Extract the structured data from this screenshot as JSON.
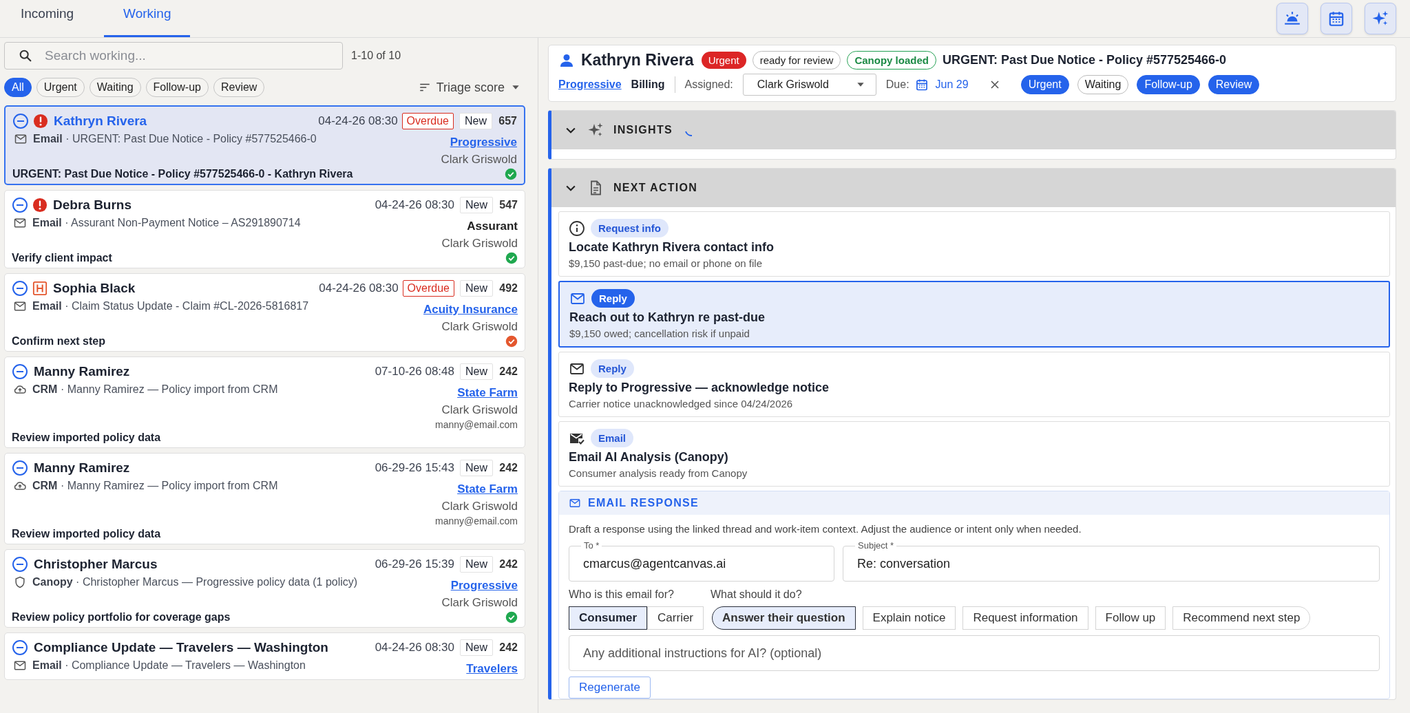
{
  "tabs": [
    {
      "label": "Incoming",
      "selected": false
    },
    {
      "label": "Working",
      "selected": true
    }
  ],
  "toolbar": [
    {
      "kind": "sunrise"
    },
    {
      "kind": "calendar"
    },
    {
      "kind": "sparkles"
    }
  ],
  "search": {
    "placeholder": "Search working..."
  },
  "result_count": "1-10 of 10",
  "filters": [
    {
      "label": "All",
      "selected": true
    },
    {
      "label": "Urgent",
      "selected": false
    },
    {
      "label": "Waiting",
      "selected": false
    },
    {
      "label": "Follow-up",
      "selected": false
    },
    {
      "label": "Review",
      "selected": false
    }
  ],
  "sort": {
    "label": "Triage score"
  },
  "cards": [
    {
      "name": "Kathryn Rivera",
      "kind": "email",
      "urgent": true,
      "high": false,
      "date": "04-24-26 08:30",
      "overdue": "Overdue",
      "status": "New",
      "score": "657",
      "source_line": "**Email** · URGENT: Past Due Notice - Policy #577525466-0",
      "carrier": "Progressive",
      "carrier_link": true,
      "assignee": "Clark Griswold",
      "task": "URGENT: Past Due Notice - Policy #577525466-0 - Kathryn Rivera",
      "checked": true,
      "color": "#1fa84f",
      "selected": true
    },
    {
      "name": "Debra Burns",
      "kind": "email",
      "urgent": true,
      "high": false,
      "date": "04-24-26 08:30",
      "status": "New",
      "score": "547",
      "source_line": "**Email** · Assurant Non-Payment Notice – AS291890714",
      "carrier": "Assurant",
      "carrier_link": false,
      "assignee": "Clark Griswold",
      "task": "Verify client impact",
      "checked": true,
      "color": "#1fa84f",
      "selected": false
    },
    {
      "name": "Sophia Black",
      "kind": "email",
      "urgent": false,
      "high": true,
      "date": "04-24-26 08:30",
      "overdue": "Overdue",
      "status": "New",
      "score": "492",
      "source_line": "**Email** · Claim Status Update - Claim #CL-2026-5816817",
      "carrier": "Acuity Insurance",
      "carrier_link": true,
      "assignee": "Clark Griswold",
      "task": "Confirm next step",
      "checked": true,
      "color": "#e4572e",
      "selected": false
    },
    {
      "name": "Manny Ramirez",
      "kind": "crm",
      "urgent": false,
      "high": false,
      "date": "07-10-26 08:48",
      "status": "New",
      "score": "242",
      "source_line": "**CRM** · Manny Ramirez — Policy import from CRM",
      "carrier": "State Farm",
      "carrier_link": true,
      "assignee": "Clark Griswold",
      "email": "manny@email.com",
      "task": "Review imported policy data",
      "checked": false,
      "selected": false
    },
    {
      "name": "Manny Ramirez",
      "kind": "crm",
      "urgent": false,
      "high": false,
      "date": "06-29-26 15:43",
      "status": "New",
      "score": "242",
      "source_line": "**CRM** · Manny Ramirez — Policy import from CRM",
      "carrier": "State Farm",
      "carrier_link": true,
      "assignee": "Clark Griswold",
      "email": "manny@email.com",
      "task": "Review imported policy data",
      "checked": false,
      "selected": false
    },
    {
      "name": "Christopher Marcus",
      "kind": "canopy",
      "urgent": false,
      "high": false,
      "date": "06-29-26 15:39",
      "status": "New",
      "score": "242",
      "source_line": "**Canopy** · Christopher Marcus — Progressive policy data (1 policy)",
      "carrier": "Progressive",
      "carrier_link": true,
      "assignee": "Clark Griswold",
      "task": "Review policy portfolio for coverage gaps",
      "checked": true,
      "color": "#1fa84f",
      "selected": false
    },
    {
      "name": "Compliance Update — Travelers — Washington",
      "kind": "email",
      "urgent": false,
      "high": false,
      "date": "04-24-26 08:30",
      "status": "New",
      "score": "242",
      "source_line": "**Email** · Compliance Update — Travelers — Washington",
      "carrier": "Travelers",
      "carrier_link": true,
      "checked": false,
      "selected": false
    }
  ],
  "detail": {
    "name": "Kathryn Rivera",
    "badges": [
      {
        "label": "Urgent",
        "kind": "urgent"
      },
      {
        "label": "ready for review",
        "kind": "outline"
      },
      {
        "label": "Canopy loaded",
        "kind": "success"
      }
    ],
    "title": "URGENT: Past Due Notice - Policy #577525466-0",
    "carrier": "Progressive",
    "category": "Billing",
    "assigned_label": "Assigned:",
    "assignee": "Clark Griswold",
    "due_label": "Due:",
    "due": "Jun 29",
    "tags": [
      {
        "label": "Urgent",
        "selected": true
      },
      {
        "label": "Waiting",
        "selected": false
      },
      {
        "label": "Follow-up",
        "selected": true
      },
      {
        "label": "Review",
        "selected": true
      }
    ]
  },
  "insights": {
    "title": "INSIGHTS",
    "expanded": true,
    "loading": true
  },
  "next_action": {
    "title": "NEXT ACTION",
    "expanded": true,
    "items": [
      {
        "kind": "info",
        "tag": "Request info",
        "title": "Locate Kathryn Rivera contact info",
        "detail": "$9,150 past-due; no email or phone on file",
        "selected": false
      },
      {
        "kind": "reply",
        "tag": "Reply",
        "title": "Reach out to Kathryn re past-due",
        "detail": "$9,150 owed; cancellation risk if unpaid",
        "selected": true
      },
      {
        "kind": "reply",
        "tag": "Reply",
        "title": "Reply to Progressive — acknowledge notice",
        "detail": "Carrier notice unacknowledged since 04/24/2026",
        "selected": false
      },
      {
        "kind": "email",
        "tag": "Email",
        "title": "Email AI Analysis (Canopy)",
        "detail": "Consumer analysis ready from Canopy",
        "selected": false
      }
    ]
  },
  "email_response": {
    "title": "EMAIL RESPONSE",
    "description": "Draft a response using the linked thread and work-item context. Adjust the audience or intent only when needed.",
    "to": {
      "label": "To *",
      "value": "cmarcus@agentcanvas.ai"
    },
    "subject": {
      "label": "Subject *",
      "value": "Re: conversation"
    },
    "audience": {
      "label": "Who is this email for?",
      "options": [
        {
          "label": "Consumer",
          "selected": true
        },
        {
          "label": "Carrier",
          "selected": false
        }
      ]
    },
    "intent": {
      "label": "What should it do?",
      "options": [
        {
          "label": "Answer their question",
          "selected": true
        },
        {
          "label": "Explain notice",
          "selected": false
        },
        {
          "label": "Request information",
          "selected": false
        },
        {
          "label": "Follow up",
          "selected": false
        },
        {
          "label": "Recommend next step",
          "selected": false
        }
      ]
    },
    "instructions": {
      "placeholder": "Any additional instructions for AI? (optional)"
    },
    "regenerate": "Regenerate"
  }
}
